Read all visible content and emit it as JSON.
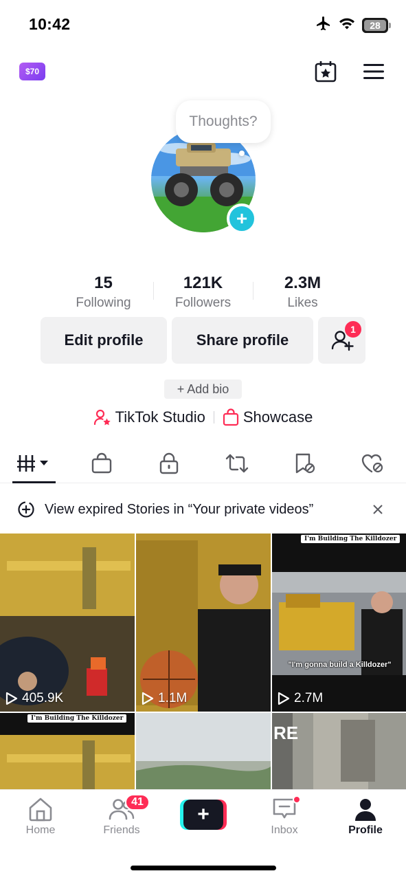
{
  "status_bar": {
    "time": "10:42",
    "battery": "28"
  },
  "header": {
    "coin_label": "$70"
  },
  "profile": {
    "thoughts_prompt": "Thoughts?"
  },
  "stats": [
    {
      "value": "15",
      "label": "Following"
    },
    {
      "value": "121K",
      "label": "Followers"
    },
    {
      "value": "2.3M",
      "label": "Likes"
    }
  ],
  "actions": {
    "edit": "Edit profile",
    "share": "Share profile",
    "friend_badge": "1"
  },
  "bio": {
    "add_label": "+ Add bio"
  },
  "links": {
    "studio": "TikTok Studio",
    "showcase": "Showcase"
  },
  "banner": {
    "text": "View expired Stories in “Your private videos”"
  },
  "videos": [
    {
      "views": "405.9K"
    },
    {
      "views": "1.1M"
    },
    {
      "views": "2.7M",
      "caption": "I'm Building The Killdozer",
      "subtitle": "\"I'm gonna build a Killdozer\""
    },
    {
      "caption": "I'm Building The Killdozer"
    },
    {},
    {
      "overlay": "RE"
    }
  ],
  "nav": {
    "home": "Home",
    "friends": "Friends",
    "friends_badge": "41",
    "inbox": "Inbox",
    "profile": "Profile"
  },
  "colors": {
    "accent": "#fe2c55",
    "cyan": "#25f4ee",
    "text": "#161823"
  }
}
